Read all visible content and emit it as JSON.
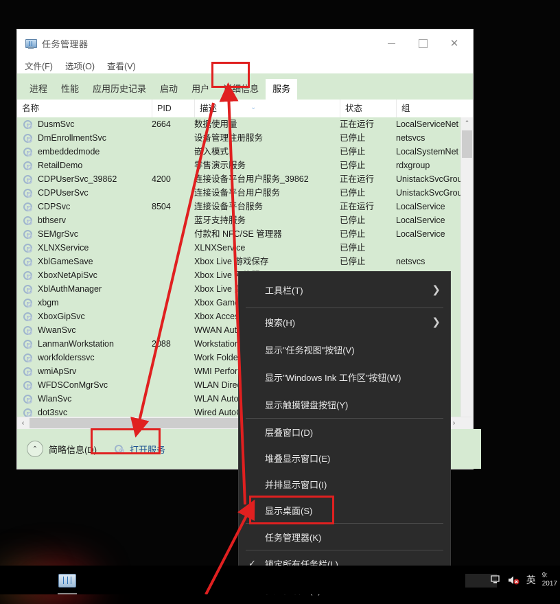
{
  "window": {
    "title": "任务管理器",
    "app_icon": "task-manager-icon",
    "controls": {
      "minimize": "—",
      "maximize": "□",
      "close": "✕"
    },
    "menu": [
      "文件(F)",
      "选项(O)",
      "查看(V)"
    ],
    "tabs": [
      {
        "label": "进程",
        "active": false
      },
      {
        "label": "性能",
        "active": false
      },
      {
        "label": "应用历史记录",
        "active": false
      },
      {
        "label": "启动",
        "active": false
      },
      {
        "label": "用户",
        "active": false
      },
      {
        "label": "详细信息",
        "active": false
      },
      {
        "label": "服务",
        "active": true
      }
    ],
    "columns": [
      "名称",
      "PID",
      "描述",
      "状态",
      "组"
    ],
    "services": [
      {
        "name": "DusmSvc",
        "pid": "2664",
        "desc": "数据使用量",
        "status": "正在运行",
        "group": "LocalServiceNet"
      },
      {
        "name": "DmEnrollmentSvc",
        "pid": "",
        "desc": "设备管理注册服务",
        "status": "已停止",
        "group": "netsvcs"
      },
      {
        "name": "embeddedmode",
        "pid": "",
        "desc": "嵌入模式",
        "status": "已停止",
        "group": "LocalSystemNet"
      },
      {
        "name": "RetailDemo",
        "pid": "",
        "desc": "零售演示服务",
        "status": "已停止",
        "group": "rdxgroup"
      },
      {
        "name": "CDPUserSvc_39862",
        "pid": "4200",
        "desc": "连接设备平台用户服务_39862",
        "status": "正在运行",
        "group": "UnistackSvcGrou"
      },
      {
        "name": "CDPUserSvc",
        "pid": "",
        "desc": "连接设备平台用户服务",
        "status": "已停止",
        "group": "UnistackSvcGrou"
      },
      {
        "name": "CDPSvc",
        "pid": "8504",
        "desc": "连接设备平台服务",
        "status": "正在运行",
        "group": "LocalService"
      },
      {
        "name": "bthserv",
        "pid": "",
        "desc": "蓝牙支持服务",
        "status": "已停止",
        "group": "LocalService"
      },
      {
        "name": "SEMgrSvc",
        "pid": "",
        "desc": "付款和 NFC/SE 管理器",
        "status": "已停止",
        "group": "LocalService"
      },
      {
        "name": "XLNXService",
        "pid": "",
        "desc": "XLNXService",
        "status": "已停止",
        "group": ""
      },
      {
        "name": "XblGameSave",
        "pid": "",
        "desc": "Xbox Live 游戏保存",
        "status": "已停止",
        "group": "netsvcs"
      },
      {
        "name": "XboxNetApiSvc",
        "pid": "",
        "desc": "Xbox Live 网络服",
        "status": "",
        "group": ""
      },
      {
        "name": "XblAuthManager",
        "pid": "",
        "desc": "Xbox Live 身份",
        "status": "",
        "group": ""
      },
      {
        "name": "xbgm",
        "pid": "",
        "desc": "Xbox Game M",
        "status": "",
        "group": ""
      },
      {
        "name": "XboxGipSvc",
        "pid": "",
        "desc": "Xbox Accesso",
        "status": "",
        "group": ""
      },
      {
        "name": "WwanSvc",
        "pid": "",
        "desc": "WWAN AutoCo",
        "status": "",
        "group": "loN"
      },
      {
        "name": "LanmanWorkstation",
        "pid": "2088",
        "desc": "Workstation",
        "status": "",
        "group": "ce"
      },
      {
        "name": "workfolderssvc",
        "pid": "",
        "desc": "Work Folders",
        "status": "",
        "group": ""
      },
      {
        "name": "wmiApSrv",
        "pid": "",
        "desc": "WMI Performa",
        "status": "",
        "group": ""
      },
      {
        "name": "WFDSConMgrSvc",
        "pid": "",
        "desc": "WLAN Direct 服",
        "status": "",
        "group": "Netv"
      },
      {
        "name": "WlanSvc",
        "pid": "",
        "desc": "WLAN AutoCor",
        "status": "",
        "group": "Netv"
      },
      {
        "name": "dot3svc",
        "pid": "",
        "desc": "Wired AutoCon",
        "status": "",
        "group": "lot"
      }
    ],
    "footer": {
      "brief_info_label": "简略信息(D)",
      "brief_info_icon": "chevron-up-circle-icon",
      "open_services_label": "打开服务",
      "open_services_icon": "services-gear-icon"
    },
    "scroll": {
      "vertical_up": "⌃",
      "vertical_down": "⌄",
      "horizontal_left": "‹",
      "horizontal_right": "›"
    },
    "sort_indicator": "⌄"
  },
  "context_menu": {
    "items": [
      {
        "label": "工具栏(T)",
        "submenu": true,
        "sep_after": true,
        "icon": ""
      },
      {
        "label": "搜索(H)",
        "submenu": true,
        "sep_after": false,
        "icon": ""
      },
      {
        "label": "显示\"任务视图\"按钮(V)",
        "submenu": false,
        "sep_after": false,
        "icon": ""
      },
      {
        "label": "显示\"Windows Ink 工作区\"按钮(W)",
        "submenu": false,
        "sep_after": false,
        "icon": ""
      },
      {
        "label": "显示触摸键盘按钮(Y)",
        "submenu": false,
        "sep_after": true,
        "icon": ""
      },
      {
        "label": "层叠窗口(D)",
        "submenu": false,
        "sep_after": false,
        "icon": ""
      },
      {
        "label": "堆叠显示窗口(E)",
        "submenu": false,
        "sep_after": false,
        "icon": ""
      },
      {
        "label": "并排显示窗口(I)",
        "submenu": false,
        "sep_after": false,
        "icon": ""
      },
      {
        "label": "显示桌面(S)",
        "submenu": false,
        "sep_after": true,
        "icon": ""
      },
      {
        "label": "任务管理器(K)",
        "submenu": false,
        "sep_after": true,
        "icon": ""
      },
      {
        "label": "锁定所有任务栏(L)",
        "submenu": false,
        "sep_after": false,
        "icon": "check-icon",
        "glyph": "✓"
      },
      {
        "label": "任务栏设置(T)",
        "submenu": false,
        "sep_after": false,
        "icon": "gear-icon",
        "glyph": "✿"
      }
    ],
    "submenu_glyph": "❯"
  },
  "taskbar": {
    "pinned_icon": "task-manager-taskbar-icon",
    "tray": [
      {
        "name": "network-icon",
        "glyph": "🖳"
      },
      {
        "name": "volume-muted-icon",
        "glyph": "🔇"
      },
      {
        "name": "ime-icon",
        "glyph": "英"
      }
    ],
    "clock": "9:\n2017"
  },
  "annotations": {
    "accent_color": "#e02020",
    "boxes": [
      {
        "name": "services-tab-highlight"
      },
      {
        "name": "open-services-highlight"
      },
      {
        "name": "task-manager-menu-highlight"
      }
    ],
    "arrows": [
      {
        "name": "arrow-tab-to-open-services"
      },
      {
        "name": "arrow-menu-to-tab"
      },
      {
        "name": "arrow-to-task-manager-item"
      }
    ]
  }
}
